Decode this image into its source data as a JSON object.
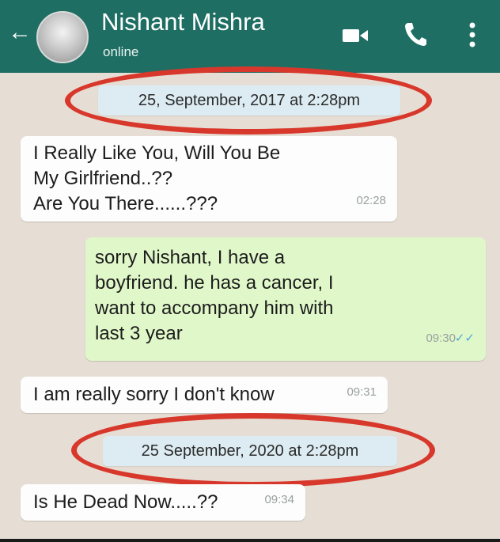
{
  "header": {
    "contact_name": "Nishant Mishra",
    "status": "online",
    "back_glyph": "←",
    "icons": [
      "back-arrow-icon",
      "video-call-icon",
      "voice-call-icon",
      "more-options-icon"
    ]
  },
  "colors": {
    "header": "#1e6e63",
    "chat_background": "#e6ded4",
    "incoming_bubble": "#fdfdfd",
    "outgoing_bubble": "#e0f8c9",
    "date_pill": "#dcecf2",
    "annotation_circle": "#d8382c",
    "read_ticks": "#4fa6d8"
  },
  "chat": {
    "date_1": "25, September,  2017 at 2:28pm",
    "msg_1": {
      "lines": [
        "I Really Like You, Will You Be",
        "My Girlfriend..??",
        "Are You There......???"
      ],
      "time": "02:28"
    },
    "msg_2": {
      "lines": [
        "sorry Nishant, I have a",
        "boyfriend. he has a cancer, I",
        "want to accompany him with",
        "last 3 year"
      ],
      "time": "09:30",
      "ticks": "✓✓"
    },
    "msg_3": {
      "text": "I am really sorry I don't know",
      "time": "09:31"
    },
    "date_2": "25 September, 2020 at 2:28pm",
    "msg_4": {
      "text": "Is He Dead Now.....??",
      "time": "09:34"
    }
  }
}
